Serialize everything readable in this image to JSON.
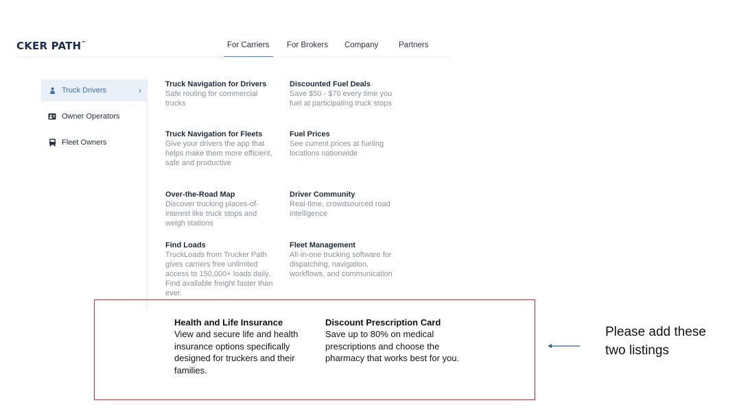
{
  "header": {
    "logo_text": "CKER PATH",
    "logo_mark": "™",
    "tabs": [
      "For Carriers",
      "For Brokers",
      "Company",
      "Partners"
    ],
    "active_tab": "For Carriers"
  },
  "sidebar": {
    "items": [
      {
        "label": "Truck Drivers",
        "icon": "driver-icon",
        "active": true
      },
      {
        "label": "Owner Operators",
        "icon": "id-card-icon",
        "active": false
      },
      {
        "label": "Fleet Owners",
        "icon": "truck-icon",
        "active": false
      }
    ],
    "active_chevron": "›"
  },
  "listings": [
    {
      "title": "Truck Navigation for Drivers",
      "desc": "Safe routing for commercial trucks"
    },
    {
      "title": "Discounted Fuel Deals",
      "desc": "Save $50 - $70 every time you fuel at participating truck stops"
    },
    {
      "title": "Truck Navigation for Fleets",
      "desc": "Give your drivers the app that helps make them more efficient, safe and productive"
    },
    {
      "title": "Fuel Prices",
      "desc": "See current prices at fueling locations nationwide"
    },
    {
      "title": "Over-the-Road Map",
      "desc": "Discover trucking places-of-interest like truck stops and weigh stations"
    },
    {
      "title": "Driver Community",
      "desc": "Real-time, crowdsourced road intelligence"
    },
    {
      "title": "Find Loads",
      "desc": "TruckLoads from Trucker Path gives carriers free unlimited access to 150,000+ loads daily. Find available freight faster than ever."
    },
    {
      "title": "Fleet Management",
      "desc": "All-in-one trucking software for dispatching, navigation, workflows, and communication"
    }
  ],
  "new_listings": [
    {
      "title": "Health and Life Insurance",
      "desc": "View and secure life and health insurance options specifically designed for truckers and their families."
    },
    {
      "title": "Discount Prescription Card",
      "desc": "Save up to 80% on medical prescriptions and choose the pharmacy that works best for you."
    }
  ],
  "annotation": {
    "text": "Please add these two listings",
    "arrow_icon": "left-arrow-icon"
  },
  "colors": {
    "accent": "#3a6ea5",
    "highlight_border": "#d9232d",
    "arrow": "#2f5d8a"
  }
}
